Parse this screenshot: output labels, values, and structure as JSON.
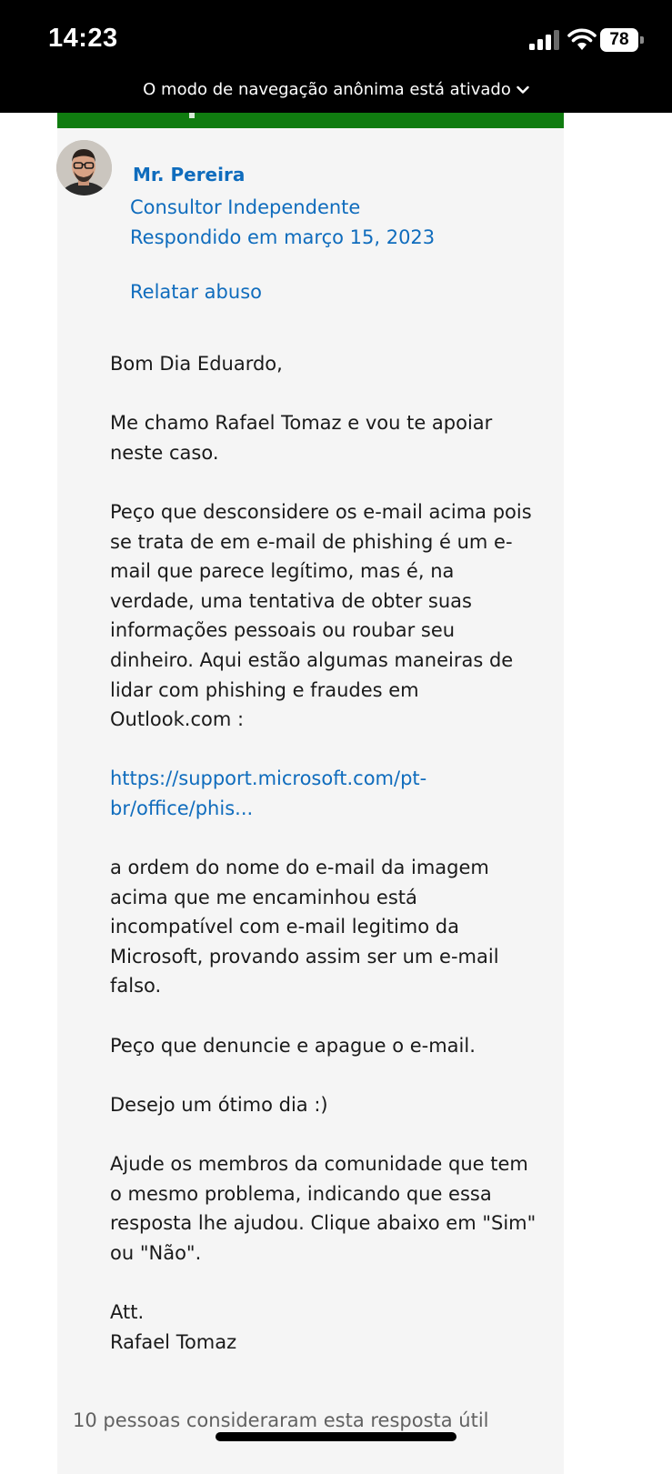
{
  "status_bar": {
    "time": "14:23",
    "battery_level": "78",
    "signal_icon": "cellular-signal-icon",
    "wifi_icon": "wifi-icon"
  },
  "browser": {
    "incognito_notice": "O modo de navegação anônima está ativado"
  },
  "answer": {
    "author_name": "Mr. Pereira",
    "author_role": "Consultor Independente",
    "answered_date": "Respondido em março 15, 2023",
    "report_abuse_label": "Relatar abuso",
    "body": {
      "greeting": "Bom Dia Eduardo,",
      "intro": "Me chamo Rafael Tomaz e vou te apoiar neste caso.",
      "explanation": "Peço que desconsidere os e-mail acima pois se trata de em e-mail de phishing é um e-mail que parece legítimo, mas é, na verdade, uma tentativa de obter suas informações pessoais ou roubar seu dinheiro. Aqui estão algumas maneiras de lidar com phishing e fraudes em Outlook.com :",
      "link_text": "https://support.microsoft.com/pt-br/office/phis...",
      "analysis": "a ordem do nome do e-mail da imagem acima que me encaminhou está incompatível com e-mail legitimo da Microsoft, provando assim ser um e-mail falso.",
      "request": "Peço que denuncie e apague o e-mail.",
      "wish": "Desejo um ótimo dia :)",
      "help_prompt": "Ajude os membros da comunidade que tem o mesmo problema, indicando que essa resposta lhe ajudou. Clique abaixo em \"Sim\" ou \"Não\".",
      "signoff": "Att.",
      "signature": "Rafael Tomaz"
    },
    "helpful_count": "10 pessoas consideraram esta resposta útil"
  },
  "colors": {
    "accent_green": "#107c10",
    "link_blue": "#0f6cbd",
    "card_background": "#f5f5f5"
  }
}
